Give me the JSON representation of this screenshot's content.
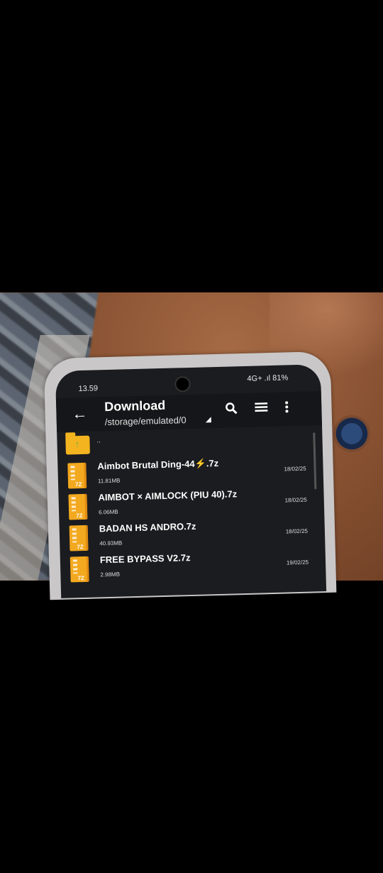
{
  "status_bar": {
    "time": "13.59",
    "right": "4G+ .ıl 81%"
  },
  "toolbar": {
    "back_icon": "arrow-left-icon",
    "title": "Download",
    "path": "/storage/emulated/0",
    "icons": [
      "search-icon",
      "list-view-icon",
      "more-vert-icon"
    ]
  },
  "list": {
    "parent_label": "..",
    "files": [
      {
        "name": "Aimbot Brutal Ding-44⚡.7z",
        "size": "11.81MB",
        "date": "18/02/25"
      },
      {
        "name": "AIMBOT × AIMLOCK (PIU 40).7z",
        "size": "6.06MB",
        "date": "18/02/25"
      },
      {
        "name": "BADAN HS ANDRO.7z",
        "size": "40.93MB",
        "date": "18/02/25"
      },
      {
        "name": "FREE BYPASS V2.7z",
        "size": "2.98MB",
        "date": "19/02/25"
      }
    ]
  },
  "colors": {
    "screen_bg": "#1b1c20",
    "archive_icon": "#f3a91f",
    "folder": "#f4b41f"
  }
}
